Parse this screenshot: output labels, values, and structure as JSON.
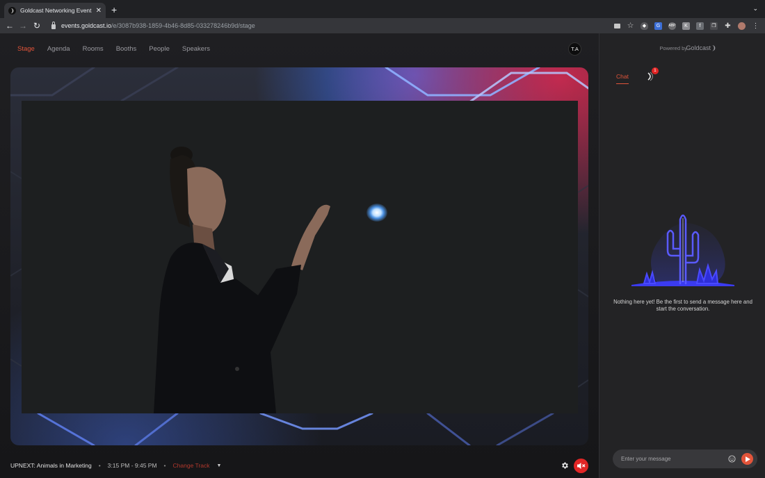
{
  "browser": {
    "tab_title": "Goldcast Networking Event",
    "url_domain": "events.goldcast.io",
    "url_path": "/e/3087b938-1859-4b46-8d85-033278246b9d/stage",
    "extensions": [
      "camera-icon",
      "star-icon",
      "shield-icon",
      "translate-icon",
      "abp-icon",
      "k-icon",
      "f-icon",
      "copy-icon",
      "puzzle-icon",
      "profile-avatar",
      "kebab-menu-icon"
    ]
  },
  "nav": {
    "items": [
      {
        "label": "Stage",
        "active": true
      },
      {
        "label": "Agenda",
        "active": false
      },
      {
        "label": "Rooms",
        "active": false
      },
      {
        "label": "Booths",
        "active": false
      },
      {
        "label": "People",
        "active": false
      },
      {
        "label": "Speakers",
        "active": false
      }
    ],
    "avatar_initials": "T.A"
  },
  "stage": {
    "upnext": "UPNEXT: Animals in Marketing",
    "time": "3:15 PM - 9:45 PM",
    "change_track": "Change Track"
  },
  "side": {
    "powered_by": "Powered by",
    "brand": "Goldcast",
    "tab_chat": "Chat",
    "notif_count": "1",
    "empty_text": "Nothing here yet! Be the first to send a message here and start the conversation.",
    "message_placeholder": "Enter your message"
  },
  "colors": {
    "accent": "#e2543a",
    "mute_red": "#e22626",
    "illustration_blue": "#3c3cf0"
  }
}
